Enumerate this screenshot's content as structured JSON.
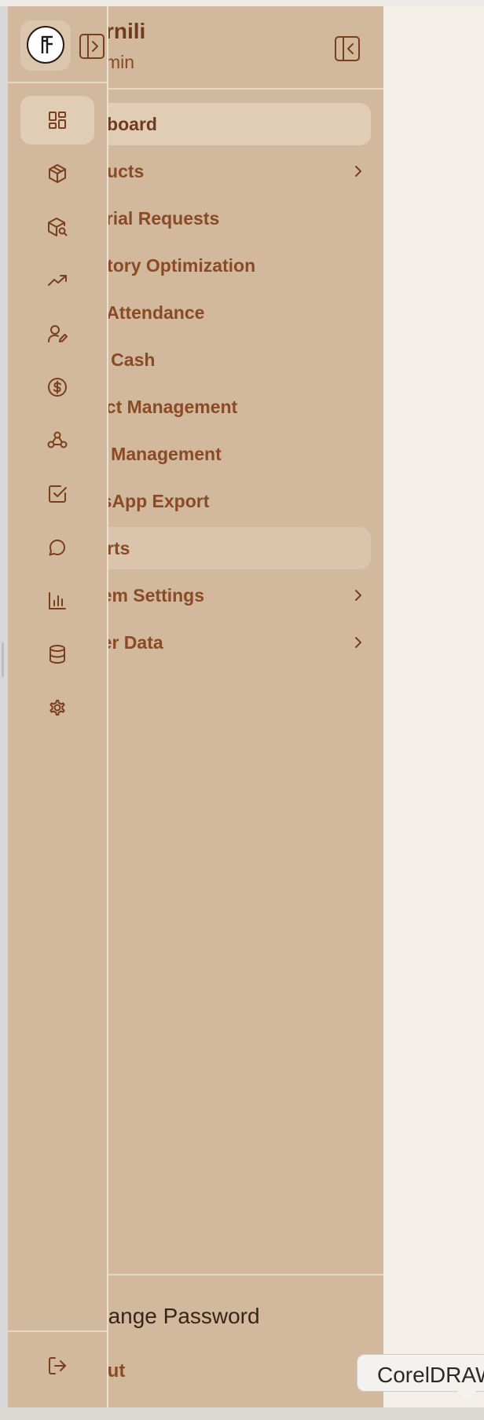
{
  "brand": {
    "name": "rnili",
    "role": "min"
  },
  "nav": {
    "items": [
      {
        "label": "hboard"
      },
      {
        "label": "ducts",
        "submenu": true
      },
      {
        "label": "erial Requests"
      },
      {
        "label": "ntory Optimization"
      },
      {
        "label": "f Attendance"
      },
      {
        "label": "y Cash"
      },
      {
        "label": "ect Management"
      },
      {
        "label": "k Management"
      },
      {
        "label": "tsApp Export"
      },
      {
        "label": "orts"
      },
      {
        "label": "tem Settings",
        "submenu": true
      },
      {
        "label": "ter Data",
        "submenu": true
      }
    ]
  },
  "footer": {
    "change_password": "hange Password",
    "logout": "out"
  },
  "rail": {
    "icons": [
      "dashboard-grid-icon",
      "package-icon",
      "package-search-icon",
      "trending-up-icon",
      "user-pen-icon",
      "dollar-circle-icon",
      "network-icon",
      "check-square-icon",
      "chat-bubble-icon",
      "bar-chart-icon",
      "database-icon",
      "settings-gear-icon"
    ]
  },
  "tooltip": {
    "text": "CorelDRAW"
  },
  "colors": {
    "sidebar_bg": "#d2b99d",
    "active_bg": "#e1ccb6",
    "text_brown": "#8a4a24",
    "main_bg": "#f3eee8"
  }
}
